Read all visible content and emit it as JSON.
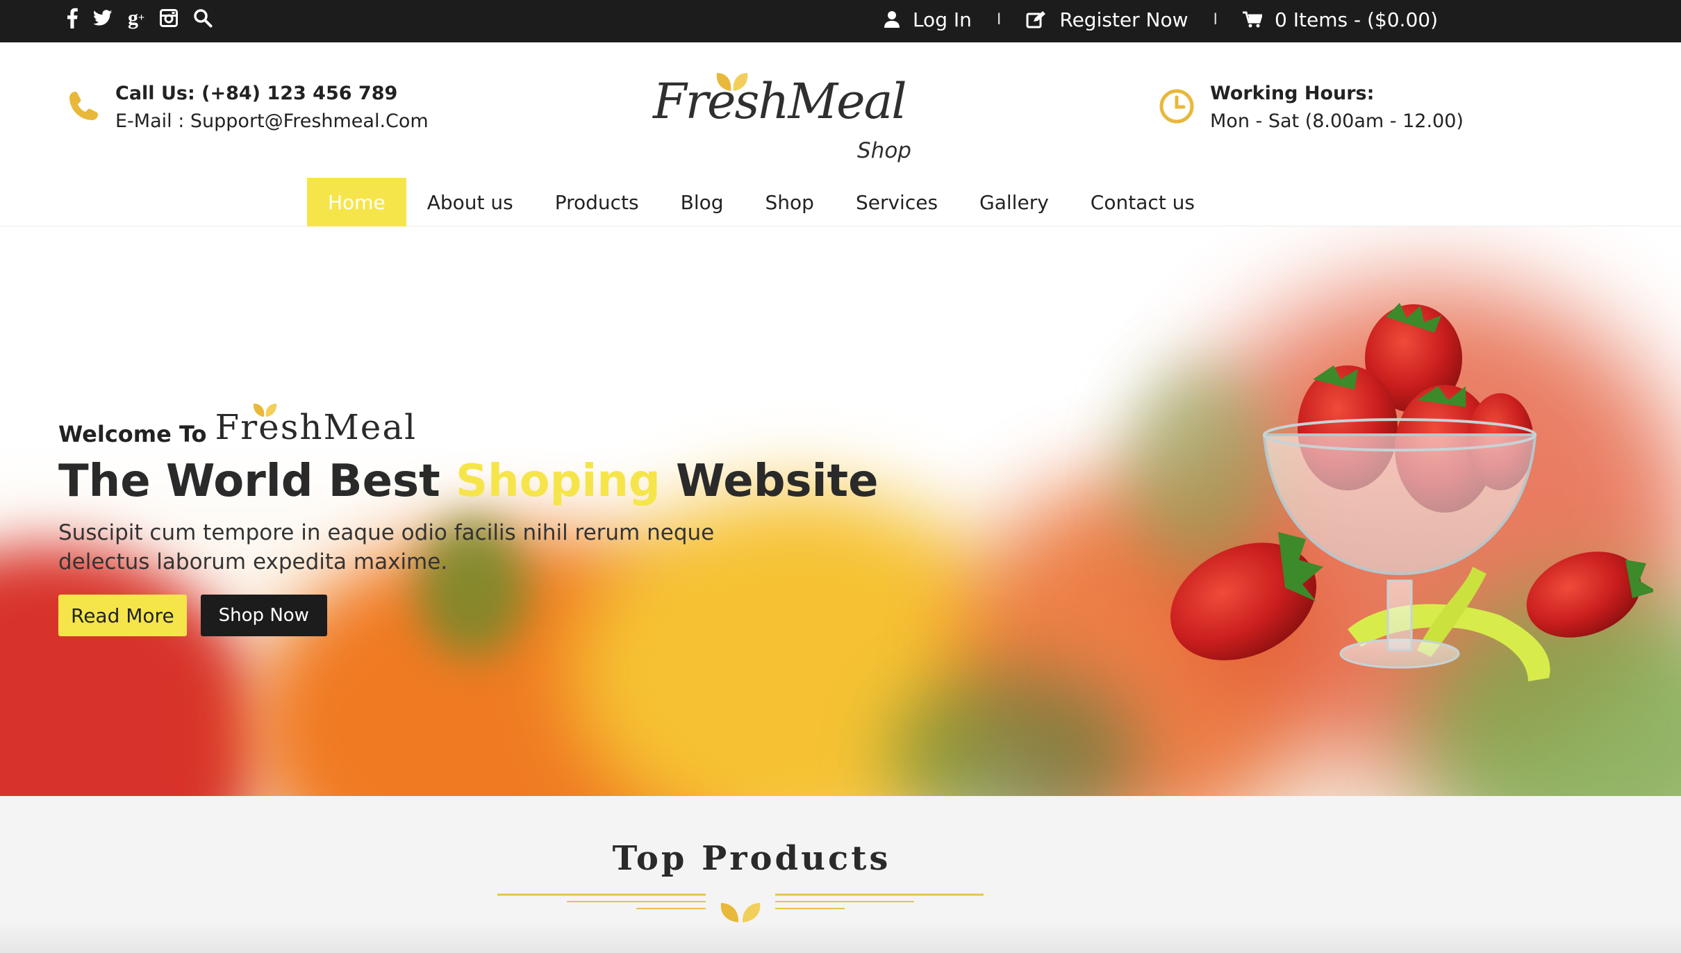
{
  "topbar": {
    "social": [
      {
        "icon": "facebook-icon"
      },
      {
        "icon": "twitter-icon"
      },
      {
        "icon": "google-plus-icon"
      },
      {
        "icon": "instagram-icon"
      },
      {
        "icon": "search-icon"
      }
    ],
    "login_label": "Log In",
    "register_label": "Register Now",
    "cart_label": "0 Items - ($0.00)",
    "separator": "I"
  },
  "header": {
    "call_label": "Call Us: (+84) 123 456 789",
    "email_label": "E-Mail : Support@Freshmeal.Com",
    "logo_text": "FreshMeal",
    "logo_sub": "Shop",
    "hours_title": "Working Hours:",
    "hours_value": "Mon - Sat (8.00am - 12.00)"
  },
  "nav": {
    "items": [
      {
        "label": "Home",
        "active": true
      },
      {
        "label": "About us"
      },
      {
        "label": "Products"
      },
      {
        "label": "Blog"
      },
      {
        "label": "Shop"
      },
      {
        "label": "Services"
      },
      {
        "label": "Gallery"
      },
      {
        "label": "Contact us"
      }
    ]
  },
  "hero": {
    "welcome": "Welcome To",
    "brand": "FreshMeal",
    "headline_part1": "The World Best",
    "headline_highlight": "Shoping",
    "headline_part2": "Website",
    "paragraph": "Suscipit cum tempore in eaque odio facilis nihil rerum neque delectus laborum expedita maxime.",
    "read_more": "Read More",
    "shop_now": "Shop Now"
  },
  "products": {
    "title": "Top Products"
  },
  "colors": {
    "accent": "#f5e54a",
    "icon_gold": "#e8b83a",
    "topbar": "#1c1c1c"
  }
}
